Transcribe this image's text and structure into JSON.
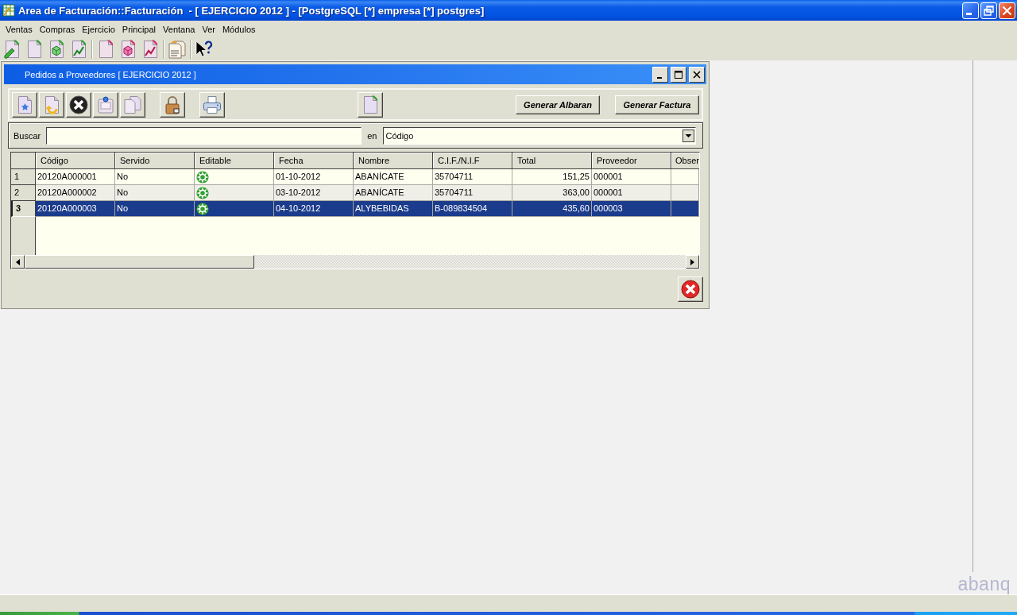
{
  "window": {
    "title": "Area de Facturación::Facturación  - [ EJERCICIO 2012 ] - [PostgreSQL [*] empresa [*] postgres]"
  },
  "menu": [
    "Ventas",
    "Compras",
    "Ejercicio",
    "Principal",
    "Ventana",
    "Ver",
    "Módulos"
  ],
  "child_window": {
    "title": "Pedidos a Proveedores [ EJERCICIO 2012 ]",
    "actions": [
      "Generar Albaran",
      "Generar Factura"
    ],
    "search": {
      "label": "Buscar",
      "in_label": "en",
      "field": "Código"
    },
    "table": {
      "columns": [
        {
          "label": "Código",
          "kind": "text"
        },
        {
          "label": "Servido",
          "kind": "text"
        },
        {
          "label": "Editable",
          "kind": "flag"
        },
        {
          "label": "Fecha",
          "kind": "text"
        },
        {
          "label": "Nombre",
          "kind": "text"
        },
        {
          "label": "C.I.F./N.I.F",
          "kind": "text"
        },
        {
          "label": "Total",
          "kind": "amount"
        },
        {
          "label": "Proveedor",
          "kind": "text"
        },
        {
          "label": "Obser",
          "kind": "text"
        }
      ],
      "rows": [
        {
          "number": "1",
          "selected": false,
          "editable": true,
          "cells": [
            "20120A000001",
            "No",
            "",
            "01-10-2012",
            "ABANÍCATE",
            "35704711",
            "151,25",
            "000001"
          ]
        },
        {
          "number": "2",
          "selected": false,
          "editable": true,
          "cells": [
            "20120A000002",
            "No",
            "",
            "03-10-2012",
            "ABANÍCATE",
            "35704711",
            "363,00",
            "000001"
          ]
        },
        {
          "number": "3",
          "selected": true,
          "editable": true,
          "cells": [
            "20120A000003",
            "No",
            "",
            "04-10-2012",
            "ALYBEBIDAS",
            "B-089834504",
            "435,60",
            "000003"
          ]
        }
      ]
    }
  },
  "logo": "abanq"
}
